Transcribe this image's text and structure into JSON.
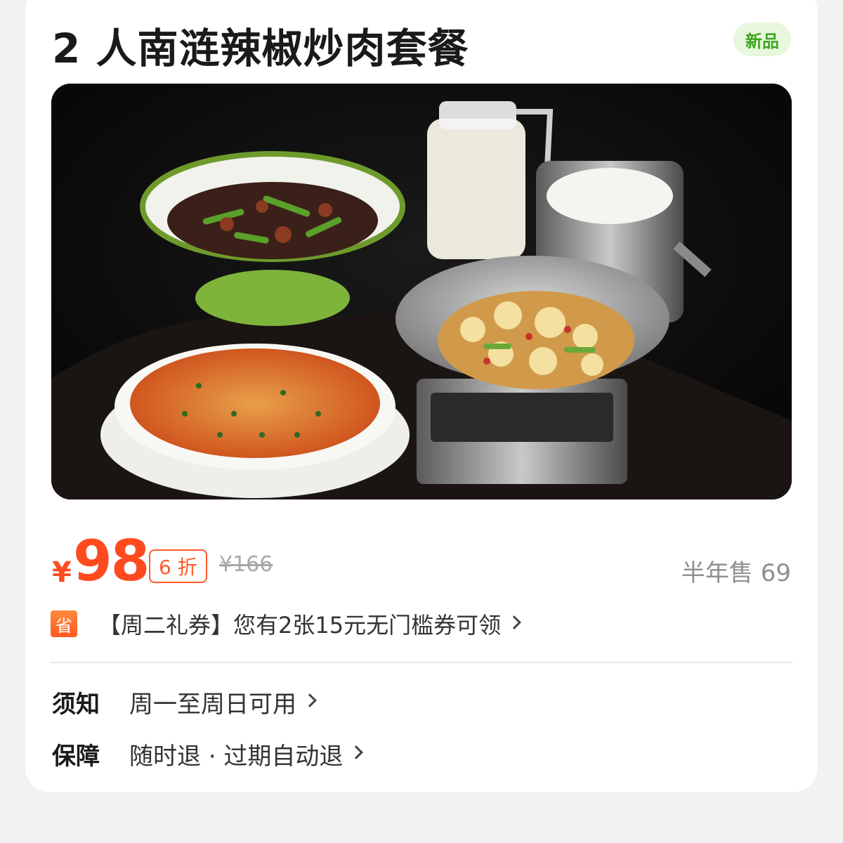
{
  "product": {
    "title": "2 人南涟辣椒炒肉套餐",
    "new_badge": "新品",
    "image_alt": "四道菜套餐图片"
  },
  "pricing": {
    "currency_symbol": "¥",
    "price": "98",
    "discount": "6 折",
    "original_price": "¥166",
    "sales": "半年售 69"
  },
  "coupon": {
    "icon_text": "省",
    "text": "【周二礼券】您有2张15元无门槛券可领"
  },
  "notice": {
    "label": "须知",
    "value": "周一至周日可用"
  },
  "guarantee": {
    "label": "保障",
    "value": "随时退 · 过期自动退"
  },
  "colors": {
    "accent": "#ff4a1f",
    "new_badge_bg": "#e8f7dd",
    "new_badge_text": "#3ea61f",
    "muted": "#a8a8a8"
  },
  "icons": [
    "chevron-right-icon",
    "save-coupon-icon"
  ]
}
